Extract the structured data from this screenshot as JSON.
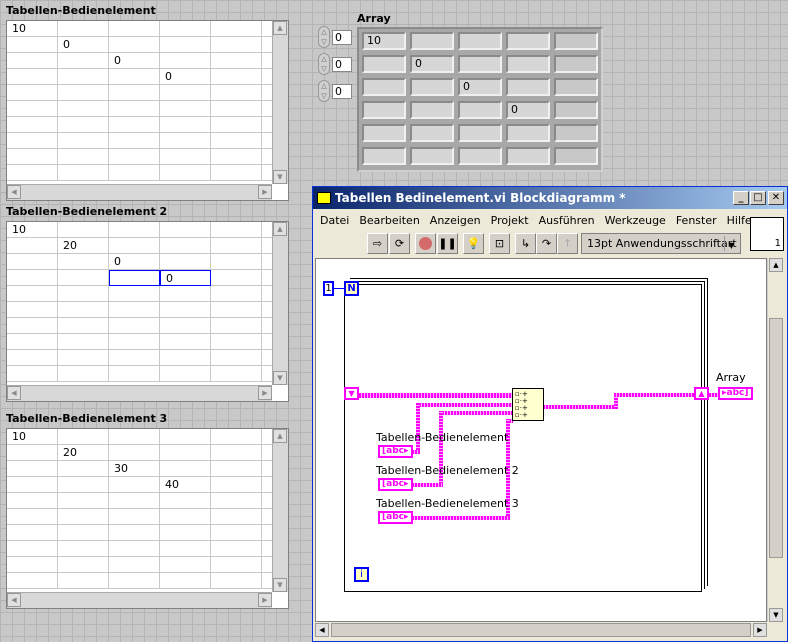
{
  "tables": [
    {
      "label": "Tabellen-Bedienelement",
      "cells": [
        [
          "10",
          "",
          "",
          "",
          ""
        ],
        [
          "",
          "0",
          "",
          "",
          ""
        ],
        [
          "",
          "",
          "0",
          "",
          ""
        ],
        [
          "",
          "",
          "",
          "0",
          ""
        ]
      ],
      "selected": []
    },
    {
      "label": "Tabellen-Bedienelement 2",
      "cells": [
        [
          "10",
          "",
          "",
          "",
          ""
        ],
        [
          "",
          "20",
          "",
          "",
          ""
        ],
        [
          "",
          "",
          "0",
          "",
          ""
        ],
        [
          "",
          "",
          "",
          "0",
          ""
        ]
      ],
      "selected": [
        [
          3,
          2
        ],
        [
          3,
          3
        ]
      ]
    },
    {
      "label": "Tabellen-Bedienelement 3",
      "cells": [
        [
          "10",
          "",
          "",
          "",
          ""
        ],
        [
          "",
          "20",
          "",
          "",
          ""
        ],
        [
          "",
          "",
          "30",
          "",
          ""
        ],
        [
          "",
          "",
          "",
          "40",
          ""
        ]
      ],
      "selected": []
    }
  ],
  "array": {
    "label": "Array",
    "indices": [
      "0",
      "0",
      "0"
    ],
    "cells": [
      [
        "10",
        "",
        "",
        "",
        ""
      ],
      [
        "",
        "0",
        "",
        "",
        ""
      ],
      [
        "",
        "",
        "0",
        "",
        ""
      ],
      [
        "",
        "",
        "",
        "0",
        ""
      ],
      [
        "",
        "",
        "",
        "",
        ""
      ],
      [
        "",
        "",
        "",
        "",
        ""
      ]
    ]
  },
  "window": {
    "title": "Tabellen Bedinelement.vi Blockdiagramm *",
    "menu": [
      "Datei",
      "Bearbeiten",
      "Anzeigen",
      "Projekt",
      "Ausführen",
      "Werkzeuge",
      "Fenster",
      "Hilfe"
    ],
    "font_select": "13pt Anwendungsschriftart",
    "icon_number": "1"
  },
  "diagram": {
    "count_const": "1",
    "count_terminal": "N",
    "iteration_terminal": "i",
    "terminals": [
      "Tabellen-Bedienelement",
      "Tabellen-Bedienelement 2",
      "Tabellen-Bedienelement 3"
    ],
    "output_label": "Array",
    "terminal_glyph": "abc",
    "wire_color": "#ff00ff",
    "structure_color": "#0000ff"
  }
}
